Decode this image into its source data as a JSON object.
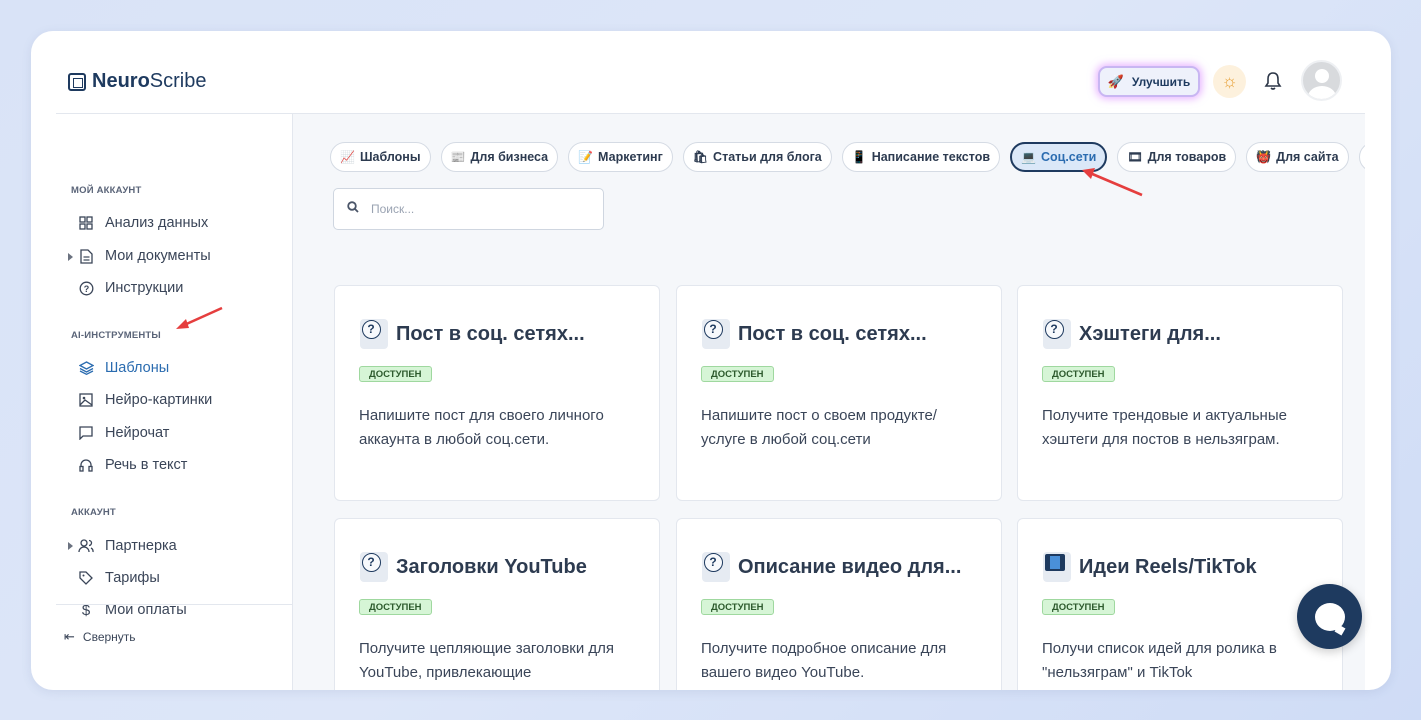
{
  "header": {
    "logo_bold": "Neuro",
    "logo_rest": "Scribe",
    "upgrade_label": "Улучшить"
  },
  "sidebar": {
    "sections": [
      {
        "title": "МОЙ АККАУНТ"
      },
      {
        "title": "AI-ИНСТРУМЕНТЫ"
      },
      {
        "title": "АККАУНТ"
      }
    ],
    "items": [
      {
        "label": "Анализ данных",
        "icon": "grid-icon"
      },
      {
        "label": "Мои документы",
        "icon": "document-icon"
      },
      {
        "label": "Инструкции",
        "icon": "help-circle-icon"
      },
      {
        "label": "Шаблоны",
        "icon": "layers-icon",
        "active": true
      },
      {
        "label": "Нейро-картинки",
        "icon": "image-icon"
      },
      {
        "label": "Нейрочат",
        "icon": "chat-icon"
      },
      {
        "label": "Речь в текст",
        "icon": "headphones-icon"
      },
      {
        "label": "Партнерка",
        "icon": "users-icon"
      },
      {
        "label": "Тарифы",
        "icon": "tag-icon"
      },
      {
        "label": "Мои оплаты",
        "icon": "dollar-icon"
      }
    ],
    "collapse_label": "Свернуть"
  },
  "main": {
    "chips": [
      {
        "label": "Шаблоны",
        "emoji": "📈"
      },
      {
        "label": "Для бизнеса",
        "emoji": "📰"
      },
      {
        "label": "Маркетинг",
        "emoji": "📝"
      },
      {
        "label": "Статьи для блога",
        "emoji": "🛍"
      },
      {
        "label": "Написание текстов",
        "emoji": "📱"
      },
      {
        "label": "Соц.сети",
        "emoji": "💻",
        "active": true
      },
      {
        "label": "Для товаров",
        "emoji": "🎞"
      },
      {
        "label": "Для сайта",
        "emoji": "👹"
      }
    ],
    "search": {
      "placeholder": "Поиск..."
    },
    "cards": [
      {
        "title": "Пост в соц. сетях...",
        "badge": "ДОСТУПЕН",
        "desc": "Напишите пост для своего личного аккаунта в любой соц.сети.",
        "icon": "question-icon"
      },
      {
        "title": "Пост в соц. сетях...",
        "badge": "ДОСТУПЕН",
        "desc": "Напишите пост о своем продукте/услуге в любой соц.сети",
        "icon": "question-icon"
      },
      {
        "title": "Хэштеги для...",
        "badge": "ДОСТУПЕН",
        "desc": "Получите трендовые и актуальные хэштеги для постов в нельзяграм.",
        "icon": "question-icon"
      },
      {
        "title": "Заголовки YouTube",
        "badge": "ДОСТУПЕН",
        "desc": "Получите цепляющие заголовки для YouTube, привлекающие",
        "icon": "question-icon"
      },
      {
        "title": "Описание видео для...",
        "badge": "ДОСТУПЕН",
        "desc": "Получите подробное описание для вашего видео YouTube.",
        "icon": "question-icon"
      },
      {
        "title": "Идеи Reels/TikTok",
        "badge": "ДОСТУПЕН",
        "desc": "Получи список идей для ролика в \"нельзяграм\" и TikTok",
        "icon": "film-icon"
      }
    ]
  }
}
